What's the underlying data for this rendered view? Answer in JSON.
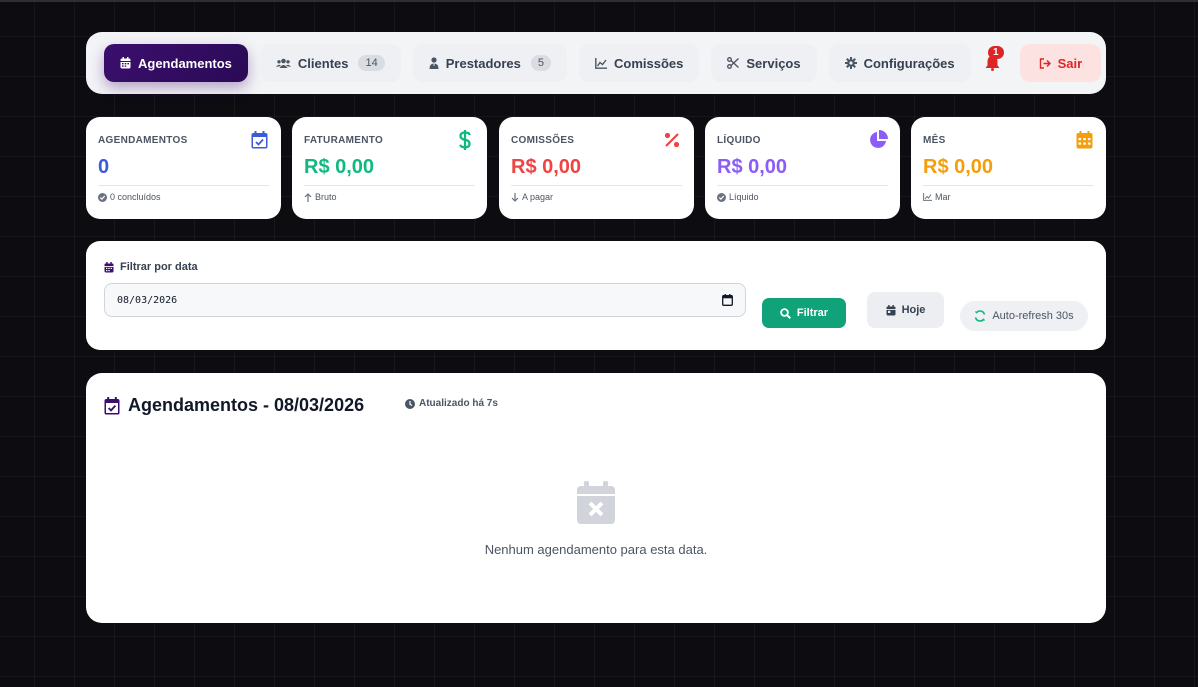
{
  "nav": {
    "items": [
      {
        "label": "Agendamentos",
        "icon": "calendar-icon",
        "active": true
      },
      {
        "label": "Clientes",
        "icon": "users-icon",
        "badge": "14"
      },
      {
        "label": "Prestadores",
        "icon": "user-tie-icon",
        "badge": "5"
      },
      {
        "label": "Comissões",
        "icon": "chart-line-icon"
      },
      {
        "label": "Serviços",
        "icon": "scissors-icon"
      },
      {
        "label": "Configurações",
        "icon": "gear-icon"
      }
    ],
    "notifications_count": "1",
    "logout_label": "Sair"
  },
  "stats": [
    {
      "label": "AGENDAMENTOS",
      "value": "0",
      "foot": "0 concluídos",
      "color": "#3b5bdb",
      "icon": "calendar-check-icon"
    },
    {
      "label": "FATURAMENTO",
      "value": "R$ 0,00",
      "foot": "Bruto",
      "color": "#10b981",
      "icon": "dollar-icon"
    },
    {
      "label": "COMISSÕES",
      "value": "R$ 0,00",
      "foot": "A pagar",
      "color": "#ef4444",
      "icon": "percent-icon"
    },
    {
      "label": "LÍQUIDO",
      "value": "R$ 0,00",
      "foot": "Líquido",
      "color": "#8b5cf6",
      "icon": "pie-chart-icon"
    },
    {
      "label": "MÊS",
      "value": "R$ 0,00",
      "foot": "Mar",
      "color": "#f59e0b",
      "icon": "calendar-month-icon"
    }
  ],
  "filter": {
    "label": "Filtrar por data",
    "date_value": "08/03/2026",
    "filter_button": "Filtrar",
    "today_button": "Hoje",
    "autorefresh": "Auto-refresh 30s"
  },
  "appointments": {
    "title": "Agendamentos - 08/03/2026",
    "updated": "Atualizado há 7s",
    "empty_message": "Nenhum agendamento para esta data."
  },
  "colors": {
    "accent": "#3b0f6e",
    "success": "#10a37a",
    "danger": "#dc2626"
  }
}
